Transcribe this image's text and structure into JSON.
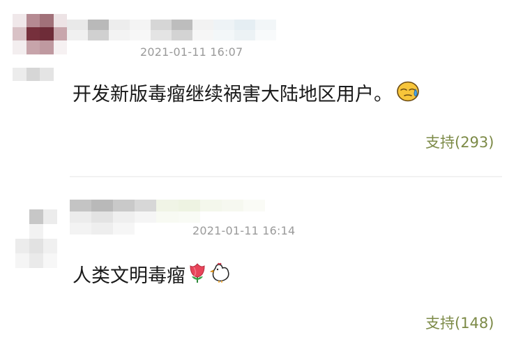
{
  "comments": [
    {
      "timestamp": "2021-01-11 16:07",
      "text": "开发新版毒瘤继续祸害大陆地区用户。",
      "emoji": "cold-sweat-emoji",
      "like_label": "支持(293)"
    },
    {
      "timestamp": "2021-01-11 16:14",
      "text": "人类文明毒瘤",
      "emoji": [
        "tulip-emoji",
        "chicken-emoji"
      ],
      "like_label": "支持(148)"
    }
  ]
}
